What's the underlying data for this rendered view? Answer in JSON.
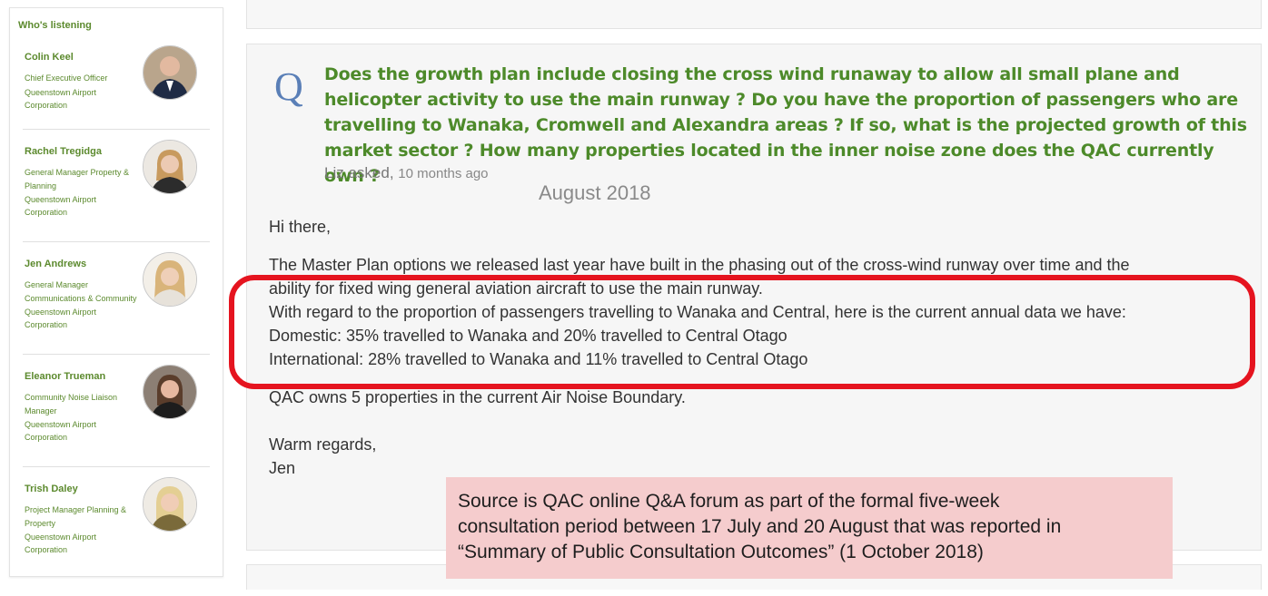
{
  "sidebar": {
    "title": "Who's listening",
    "people": [
      {
        "name": "Colin Keel",
        "role": "Chief Executive Officer",
        "org": "Queenstown Airport Corporation"
      },
      {
        "name": "Rachel Tregidga",
        "role": "General Manager Property & Planning",
        "org": "Queenstown Airport Corporation"
      },
      {
        "name": "Jen Andrews",
        "role": "General Manager Communications & Community",
        "org": "Queenstown Airport Corporation"
      },
      {
        "name": "Eleanor Trueman",
        "role": "Community Noise Liaison Manager",
        "org": "Queenstown Airport Corporation"
      },
      {
        "name": "Trish Daley",
        "role": "Project Manager Planning & Property",
        "org": "Queenstown Airport Corporation"
      }
    ]
  },
  "question": {
    "marker": "Q",
    "text": "Does the growth plan include closing the cross wind runaway to allow all small plane and helicopter activity to use the main runway ? Do you have the proportion of passengers who are travelling to Wanaka, Cromwell and Alexandra areas ? If so, what is the projected growth of this market sector ? How many properties located in the inner noise zone does the QAC currently own ?",
    "asker": "Liz asked,",
    "time_ago": "10 months ago"
  },
  "date_annotation": "August 2018",
  "answer": {
    "greeting": "Hi there,",
    "para1_line1": "The Master Plan options we released last year have built in the phasing out of the cross-wind runway over time and the",
    "para1_line2": "ability for fixed wing general aviation aircraft to use the main runway.",
    "para2": "With regard to the proportion of passengers travelling to Wanaka and Central, here is the current annual data we have:",
    "domestic": "Domestic: 35% travelled to Wanaka and 20% travelled to Central Otago",
    "international": "International: 28% travelled to Wanaka and 11% travelled to Central Otago",
    "properties": "QAC owns 5 properties in the current Air Noise Boundary.",
    "signoff": "Warm regards,",
    "signature": "Jen"
  },
  "source_note": {
    "line1": "Source is QAC online Q&A forum as part of the formal five-week",
    "line2": "consultation period between 17 July and 20 August that was reported in",
    "line3": "“Summary of Public Consultation Outcomes” (1 October 2018)"
  },
  "colors": {
    "brand_green": "#5c8a2e",
    "question_green": "#4d8a2a",
    "q_blue": "#5a7fb7",
    "highlight_red": "#e5141f",
    "note_pink": "#f5cccd"
  }
}
